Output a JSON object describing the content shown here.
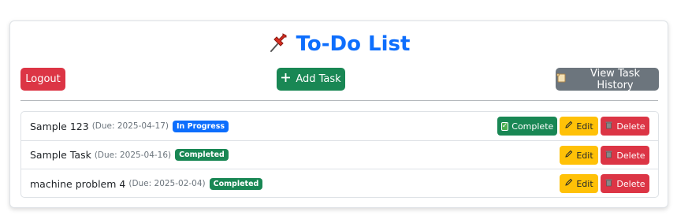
{
  "header": {
    "title": "To-Do List",
    "icon": "pushpin-icon"
  },
  "toolbar": {
    "logout_label": "Logout",
    "add_label": "Add Task",
    "history_label": "View Task History"
  },
  "tasks": [
    {
      "name": "Sample 123",
      "due": "(Due: 2025-04-17)",
      "status": "In Progress",
      "status_color": "#0d6efd",
      "show_complete": true
    },
    {
      "name": "Sample Task",
      "due": "(Due: 2025-04-16)",
      "status": "Completed",
      "status_color": "#198754",
      "show_complete": false
    },
    {
      "name": "machine problem 4",
      "due": "(Due: 2025-02-04)",
      "status": "Completed",
      "status_color": "#198754",
      "show_complete": false
    }
  ],
  "actions": {
    "complete_label": "Complete",
    "edit_label": "Edit",
    "delete_label": "Delete"
  },
  "colors": {
    "primary": "#0d6efd",
    "success": "#198754",
    "danger": "#dc3545",
    "warning": "#ffc107",
    "secondary": "#6c757d"
  }
}
